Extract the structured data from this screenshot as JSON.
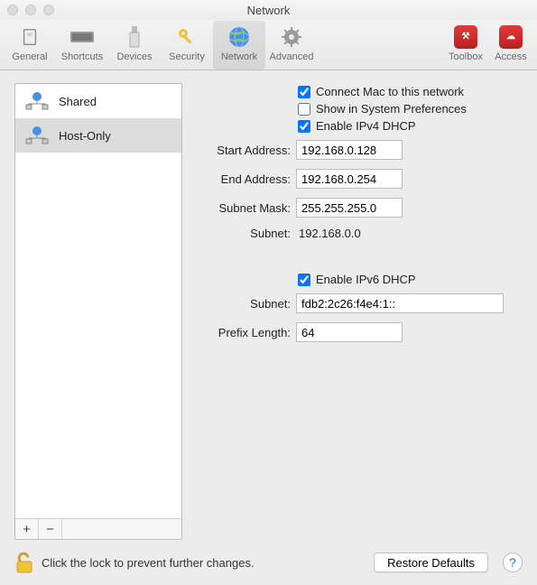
{
  "window": {
    "title": "Network"
  },
  "toolbar": {
    "items": [
      {
        "label": "General"
      },
      {
        "label": "Shortcuts"
      },
      {
        "label": "Devices"
      },
      {
        "label": "Security"
      },
      {
        "label": "Network"
      },
      {
        "label": "Advanced"
      }
    ],
    "right": [
      {
        "label": "Toolbox"
      },
      {
        "label": "Access"
      }
    ]
  },
  "sidebar": {
    "items": [
      {
        "label": "Shared"
      },
      {
        "label": "Host-Only"
      }
    ]
  },
  "form": {
    "connect_mac_label": "Connect Mac to this network",
    "show_sysprefs_label": "Show in System Preferences",
    "enable_ipv4_label": "Enable IPv4 DHCP",
    "start_address_label": "Start Address:",
    "start_address_value": "192.168.0.128",
    "end_address_label": "End Address:",
    "end_address_value": "192.168.0.254",
    "subnet_mask_label": "Subnet Mask:",
    "subnet_mask_value": "255.255.255.0",
    "subnet_label_v4": "Subnet:",
    "subnet_value_v4": "192.168.0.0",
    "enable_ipv6_label": "Enable IPv6 DHCP",
    "subnet_label_v6": "Subnet:",
    "subnet_value_v6": "fdb2:2c26:f4e4:1::",
    "prefix_length_label": "Prefix Length:",
    "prefix_length_value": "64"
  },
  "footer": {
    "add": "+",
    "remove": "−"
  },
  "bottom": {
    "lock_text": "Click the lock to prevent further changes.",
    "restore": "Restore Defaults",
    "help": "?"
  }
}
